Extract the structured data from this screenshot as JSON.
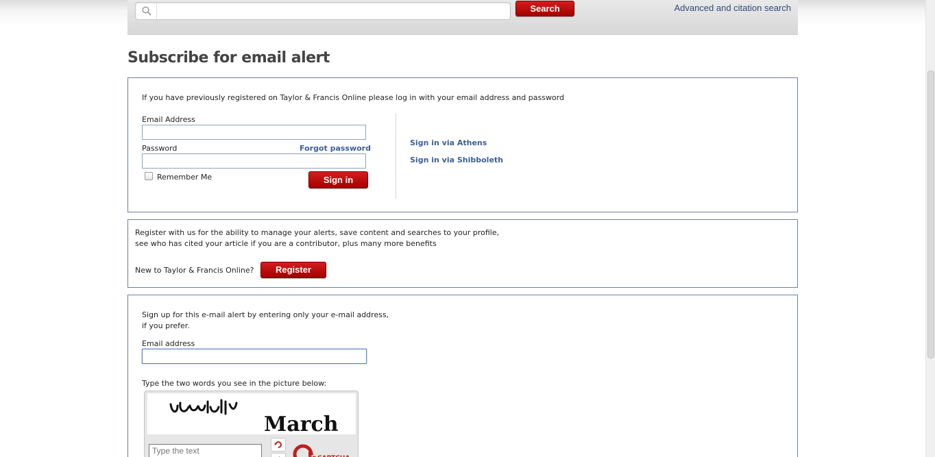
{
  "header": {
    "search_placeholder": "",
    "search_button": "Search",
    "advanced_link": "Advanced and citation search"
  },
  "page": {
    "title": "Subscribe for email alert"
  },
  "login_panel": {
    "intro": "If you have previously registered on Taylor & Francis Online please log in with your email address and password",
    "email_label": "Email Address",
    "password_label": "Password",
    "forgot_password": "Forgot password",
    "remember_me": "Remember Me",
    "sign_in_button": "Sign in",
    "sign_in_athens": "Sign in via Athens",
    "sign_in_shibboleth": "Sign in via Shibboleth"
  },
  "register_panel": {
    "line1": "Register with us for the ability to manage your alerts, save content and searches to your profile,",
    "line2": "see who has cited your article if you are a contributor, plus many more benefits",
    "new_user_label": "New to Taylor & Francis Online?",
    "register_button": "Register"
  },
  "signup_panel": {
    "line1": "Sign up for this e-mail alert by entering only your e-mail address,",
    "line2": "if you prefer.",
    "email_label": "Email address",
    "captcha_instruction": "Type the two words you see in the picture below:",
    "captcha_word1": "Ucvdvall",
    "captcha_word2": "March",
    "captcha_placeholder": "Type the text",
    "recaptcha_brand": "reCAPTCHA"
  },
  "colors": {
    "accent_red": "#b80b0b",
    "link_blue": "#3b5f99",
    "panel_border": "#6b7f9a"
  }
}
